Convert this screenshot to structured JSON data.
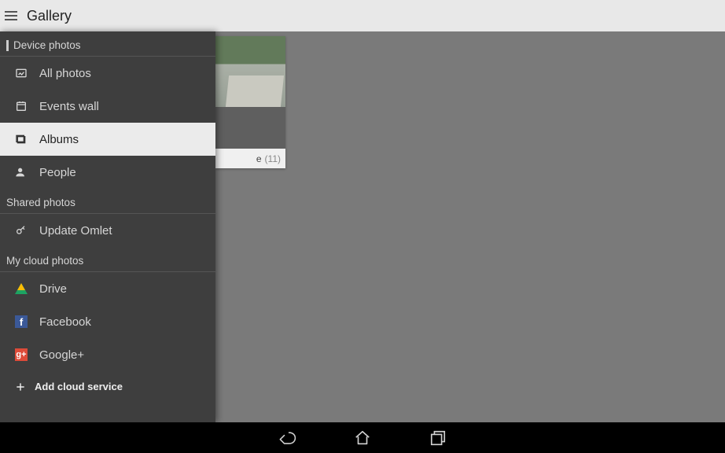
{
  "header": {
    "title": "Gallery"
  },
  "album": {
    "title_suffix": "e",
    "count": "(11)"
  },
  "drawer": {
    "section_device": "Device photos",
    "section_shared": "Shared photos",
    "section_cloud": "My cloud photos",
    "items": {
      "all_photos": "All photos",
      "events_wall": "Events wall",
      "albums": "Albums",
      "people": "People",
      "update_omlet": "Update Omlet",
      "drive": "Drive",
      "facebook": "Facebook",
      "google_plus": "Google+"
    },
    "add_service": "Add cloud service"
  },
  "icons": {
    "fb_glyph": "f",
    "gp_glyph": "g+"
  }
}
